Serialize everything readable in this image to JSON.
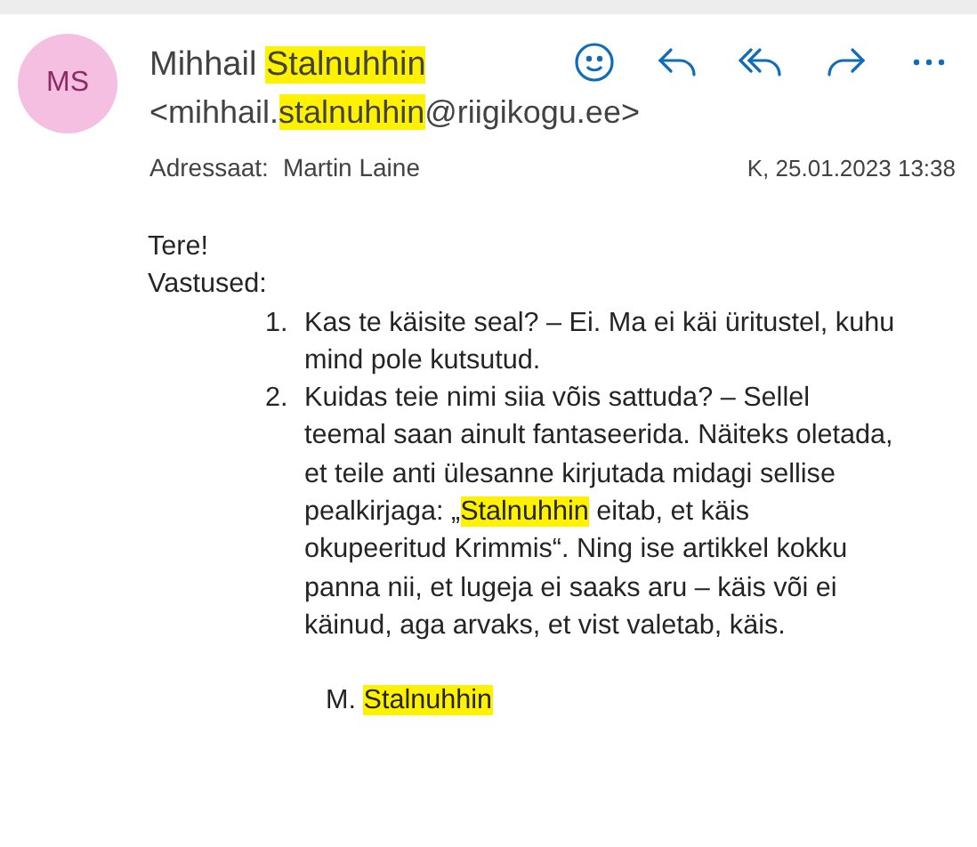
{
  "sender": {
    "initials": "MS",
    "name": [
      {
        "text": "Mihhail ",
        "highlight": false
      },
      {
        "text": "Stalnuhhin",
        "highlight": true
      }
    ],
    "email": [
      {
        "text": "<mihhail.",
        "highlight": false
      },
      {
        "text": "stalnuhhin",
        "highlight": true
      },
      {
        "text": "@riigikogu.ee>",
        "highlight": false
      }
    ]
  },
  "actions": [
    {
      "kind": "emoji"
    },
    {
      "kind": "reply"
    },
    {
      "kind": "reply_all"
    },
    {
      "kind": "forward"
    },
    {
      "kind": "more"
    }
  ],
  "recipient": {
    "label": "Adressaat:",
    "name": "Martin Laine"
  },
  "date": "K, 25.01.2023 13:38",
  "body": {
    "greeting": "Tere!",
    "intro": "Vastused:",
    "items": [
      {
        "number": "1.",
        "segments": [
          {
            "text": "Kas te käisite seal? – Ei. Ma ei käi üritustel, kuhu mind pole kutsutud.",
            "highlight": false
          }
        ]
      },
      {
        "number": "2.",
        "segments": [
          {
            "text": "Kuidas teie nimi siia võis sattuda? – Sellel teemal saan ainult fantaseerida. Näiteks oletada, et teile anti ülesanne kirjutada midagi sellise pealkirjaga: „",
            "highlight": false
          },
          {
            "text": "Stalnuhhin",
            "highlight": true
          },
          {
            "text": " eitab, et käis okupeeritud Krimmis“.  Ning ise artikkel kokku panna nii, et lugeja ei saaks aru – käis või ei käinud, aga arvaks, et vist valetab, käis.",
            "highlight": false
          }
        ]
      }
    ],
    "signature": [
      {
        "text": "M. ",
        "highlight": false
      },
      {
        "text": "Stalnuhhin",
        "highlight": true
      }
    ]
  }
}
